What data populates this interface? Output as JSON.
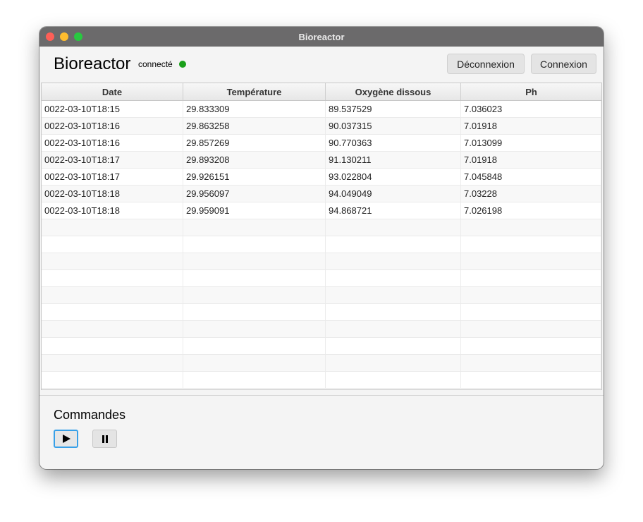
{
  "window": {
    "title": "Bioreactor"
  },
  "header": {
    "title": "Bioreactor",
    "status": "connecté",
    "status_color": "#1a9f1a",
    "buttons": {
      "disconnect": "Déconnexion",
      "connect": "Connexion"
    }
  },
  "table": {
    "columns": [
      "Date",
      "Température",
      "Oxygène dissous",
      "Ph"
    ],
    "rows": [
      [
        "0022-03-10T18:15",
        "29.833309",
        "89.537529",
        "7.036023"
      ],
      [
        "0022-03-10T18:16",
        "29.863258",
        "90.037315",
        "7.01918"
      ],
      [
        "0022-03-10T18:16",
        "29.857269",
        "90.770363",
        "7.013099"
      ],
      [
        "0022-03-10T18:17",
        "29.893208",
        "91.130211",
        "7.01918"
      ],
      [
        "0022-03-10T18:17",
        "29.926151",
        "93.022804",
        "7.045848"
      ],
      [
        "0022-03-10T18:18",
        "29.956097",
        "94.049049",
        "7.03228"
      ],
      [
        "0022-03-10T18:18",
        "29.959091",
        "94.868721",
        "7.026198"
      ]
    ]
  },
  "commands": {
    "title": "Commandes",
    "play_icon": "play-icon",
    "pause_icon": "pause-icon"
  }
}
